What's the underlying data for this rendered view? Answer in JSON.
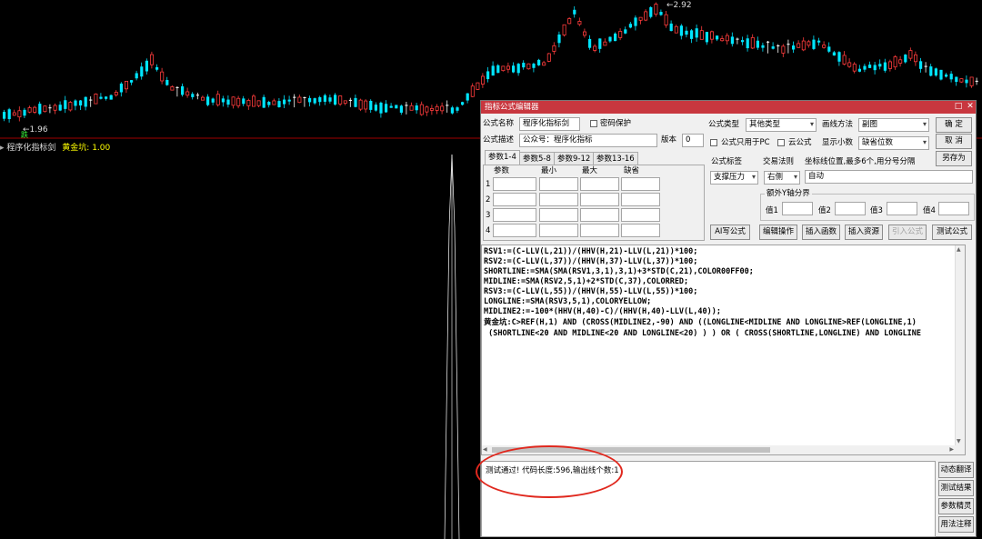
{
  "chart": {
    "high_label": "2.92",
    "low_label": "1.96",
    "sell_marker": "跌",
    "indicator_header": {
      "name": "程序化指标剑",
      "series": "黄金坑: 1.00"
    },
    "colors": {
      "up": "#ff3c3c",
      "down": "#00e5ff",
      "flat": "#ffffff",
      "marker": "#3cff3c",
      "divider": "#c80000"
    }
  },
  "editor": {
    "title": "指标公式编辑器",
    "title_buttons": [
      "□",
      "✕"
    ],
    "formula_name_label": "公式名称",
    "formula_name_value": "程序化指标剑",
    "password_label": "密码保护",
    "formula_desc_label": "公式描述",
    "formula_desc_value": "公众号：程序化指标",
    "version_label": "版本",
    "version_value": "0",
    "formula_type_label": "公式类型",
    "formula_type_value": "其他类型",
    "draw_method_label": "画线方法",
    "draw_method_value": "副图",
    "pc_only_label": "公式只用于PC",
    "cloud_label": "云公式",
    "decimals_label": "显示小数",
    "decimals_value": "缺省位数",
    "btn_ok": "确 定",
    "btn_cancel": "取 消",
    "btn_save_as": "另存为",
    "param_tabs": [
      "参数1-4",
      "参数5-8",
      "参数9-12",
      "参数13-16"
    ],
    "param_headers": [
      "参数",
      "最小",
      "最大",
      "缺省"
    ],
    "param_rows": [
      "1",
      "2",
      "3",
      "4"
    ],
    "formula_tag_label": "公式标签",
    "formula_tag_value": "支撑压力",
    "trade_rule_label": "交易法则",
    "trade_rule_value": "右侧",
    "coord_label": "坐标线位置,最多6个,用分号分隔",
    "coord_value": "自动",
    "y_axis_group_label": "额外Y轴分界",
    "value_labels": [
      "值1",
      "值2",
      "值3",
      "值4"
    ],
    "action_buttons": [
      {
        "label": "AI写公式",
        "disabled": false
      },
      {
        "label": "编辑操作",
        "disabled": false
      },
      {
        "label": "插入函数",
        "disabled": false
      },
      {
        "label": "插入资源",
        "disabled": false
      },
      {
        "label": "引入公式",
        "disabled": true
      },
      {
        "label": "测试公式",
        "disabled": false
      }
    ],
    "code_lines": [
      "RSV1:=(C-LLV(L,21))/(HHV(H,21)-LLV(L,21))*100;",
      "RSV2:=(C-LLV(L,37))/(HHV(H,37)-LLV(L,37))*100;",
      "SHORTLINE:=SMA(SMA(RSV1,3,1),3,1)+3*STD(C,21),COLOR00FF00;",
      "MIDLINE:=SMA(RSV2,5,1)+2*STD(C,37),COLORRED;",
      "RSV3:=(C-LLV(L,55))/(HHV(H,55)-LLV(L,55))*100;",
      "LONGLINE:=SMA(RSV3,5,1),COLORYELLOW;",
      "MIDLINE2:=-100*(HHV(H,40)-C)/(HHV(H,40)-LLV(L,40));",
      "黄金坑:C>REF(H,1) AND (CROSS(MIDLINE2,-90) AND ((LONGLINE<MIDLINE AND LONGLINE>REF(LONGLINE,1)",
      " (SHORTLINE<20 AND MIDLINE<20 AND LONGLINE<20) ) ) OR ( CROSS(SHORTLINE,LONGLINE) AND LONGLINE"
    ],
    "result_text": "测试通过! 代码长度:596,输出线个数:1",
    "side_buttons": [
      "动态翻译",
      "测试结果",
      "参数精灵",
      "用法注释"
    ]
  }
}
